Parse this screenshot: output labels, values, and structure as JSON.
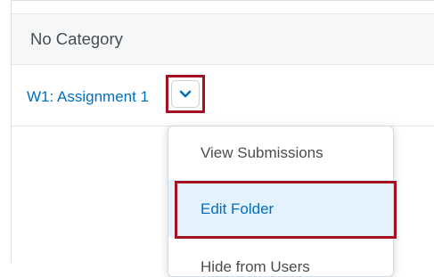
{
  "category": {
    "title": "No Category"
  },
  "assignment": {
    "title": "W1: Assignment 1",
    "menu_icon": "chevron-down-icon"
  },
  "context_menu": {
    "items": [
      {
        "label": "View Submissions",
        "selected": false
      },
      {
        "label": "Edit Folder",
        "selected": true
      },
      {
        "label": "Hide from Users",
        "selected": false
      }
    ]
  },
  "colors": {
    "link": "#006fbf",
    "highlight_box": "#a3121f",
    "selected_item_bg": "#e3f2fd",
    "header_bg": "#f6f7f8"
  }
}
